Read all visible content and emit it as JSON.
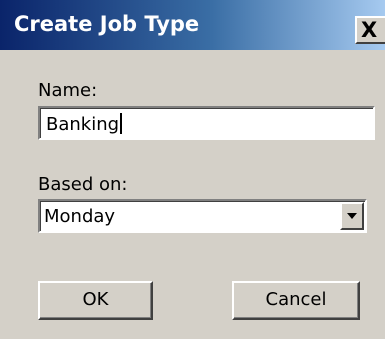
{
  "window": {
    "title": "Create Job Type",
    "close_glyph": "X"
  },
  "form": {
    "name_label": "Name:",
    "name_value": "Banking",
    "based_on_label": "Based on:",
    "based_on_value": "Monday"
  },
  "buttons": {
    "ok_label": "OK",
    "cancel_label": "Cancel"
  },
  "icons": {
    "close": "close-icon",
    "dropdown": "chevron-down-icon"
  },
  "colors": {
    "titlebar_start": "#0a246a",
    "titlebar_end": "#a6caf0",
    "dialog_face": "#d4d0c8"
  }
}
